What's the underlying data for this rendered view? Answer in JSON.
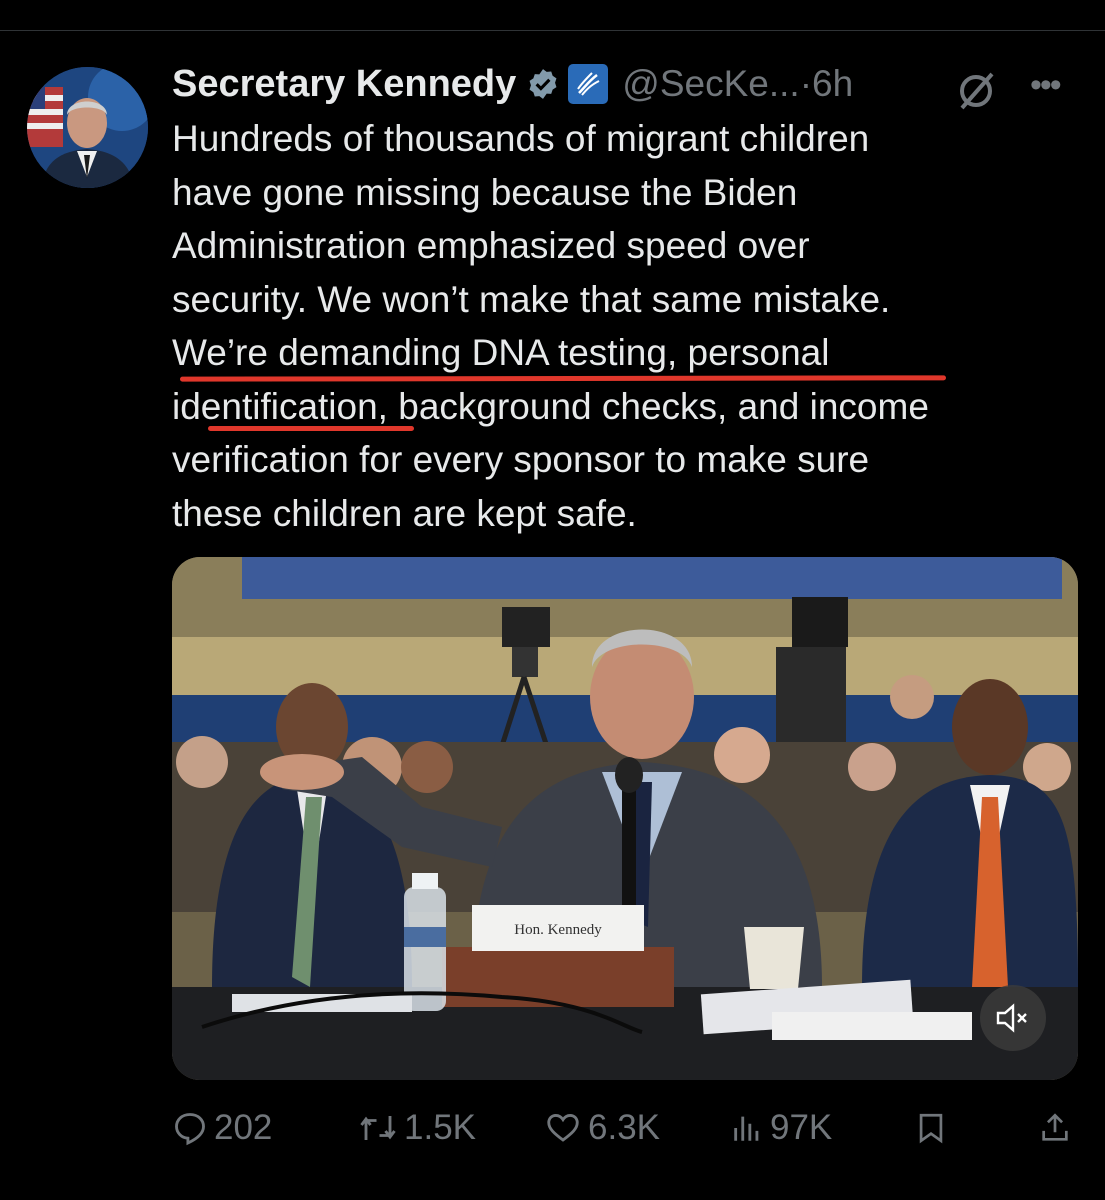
{
  "tweet": {
    "author_name": "Secretary Kennedy",
    "handle": "@SecKe...",
    "separator": "·",
    "time": "6h",
    "text": "Hundreds of thousands of migrant children\nhave gone missing because the Biden\nAdministration emphasized speed over\nsecurity. We won’t make that same mistake.\nWe’re demanding DNA testing, personal\nidentification, background checks, and income\nverification for every sponsor to make sure\nthese children are kept safe.",
    "more_label": "•••"
  },
  "media": {
    "nameplate": "Hon. Kennedy",
    "mute_icon": "speaker-muted-icon"
  },
  "actions": {
    "replies": "202",
    "reposts": "1.5K",
    "likes": "6.3K",
    "views": "97K"
  },
  "colors": {
    "background": "#000000",
    "text": "#e7e9ea",
    "muted": "#71767b",
    "verified": "#829aab",
    "annotation": "#e0372b"
  }
}
